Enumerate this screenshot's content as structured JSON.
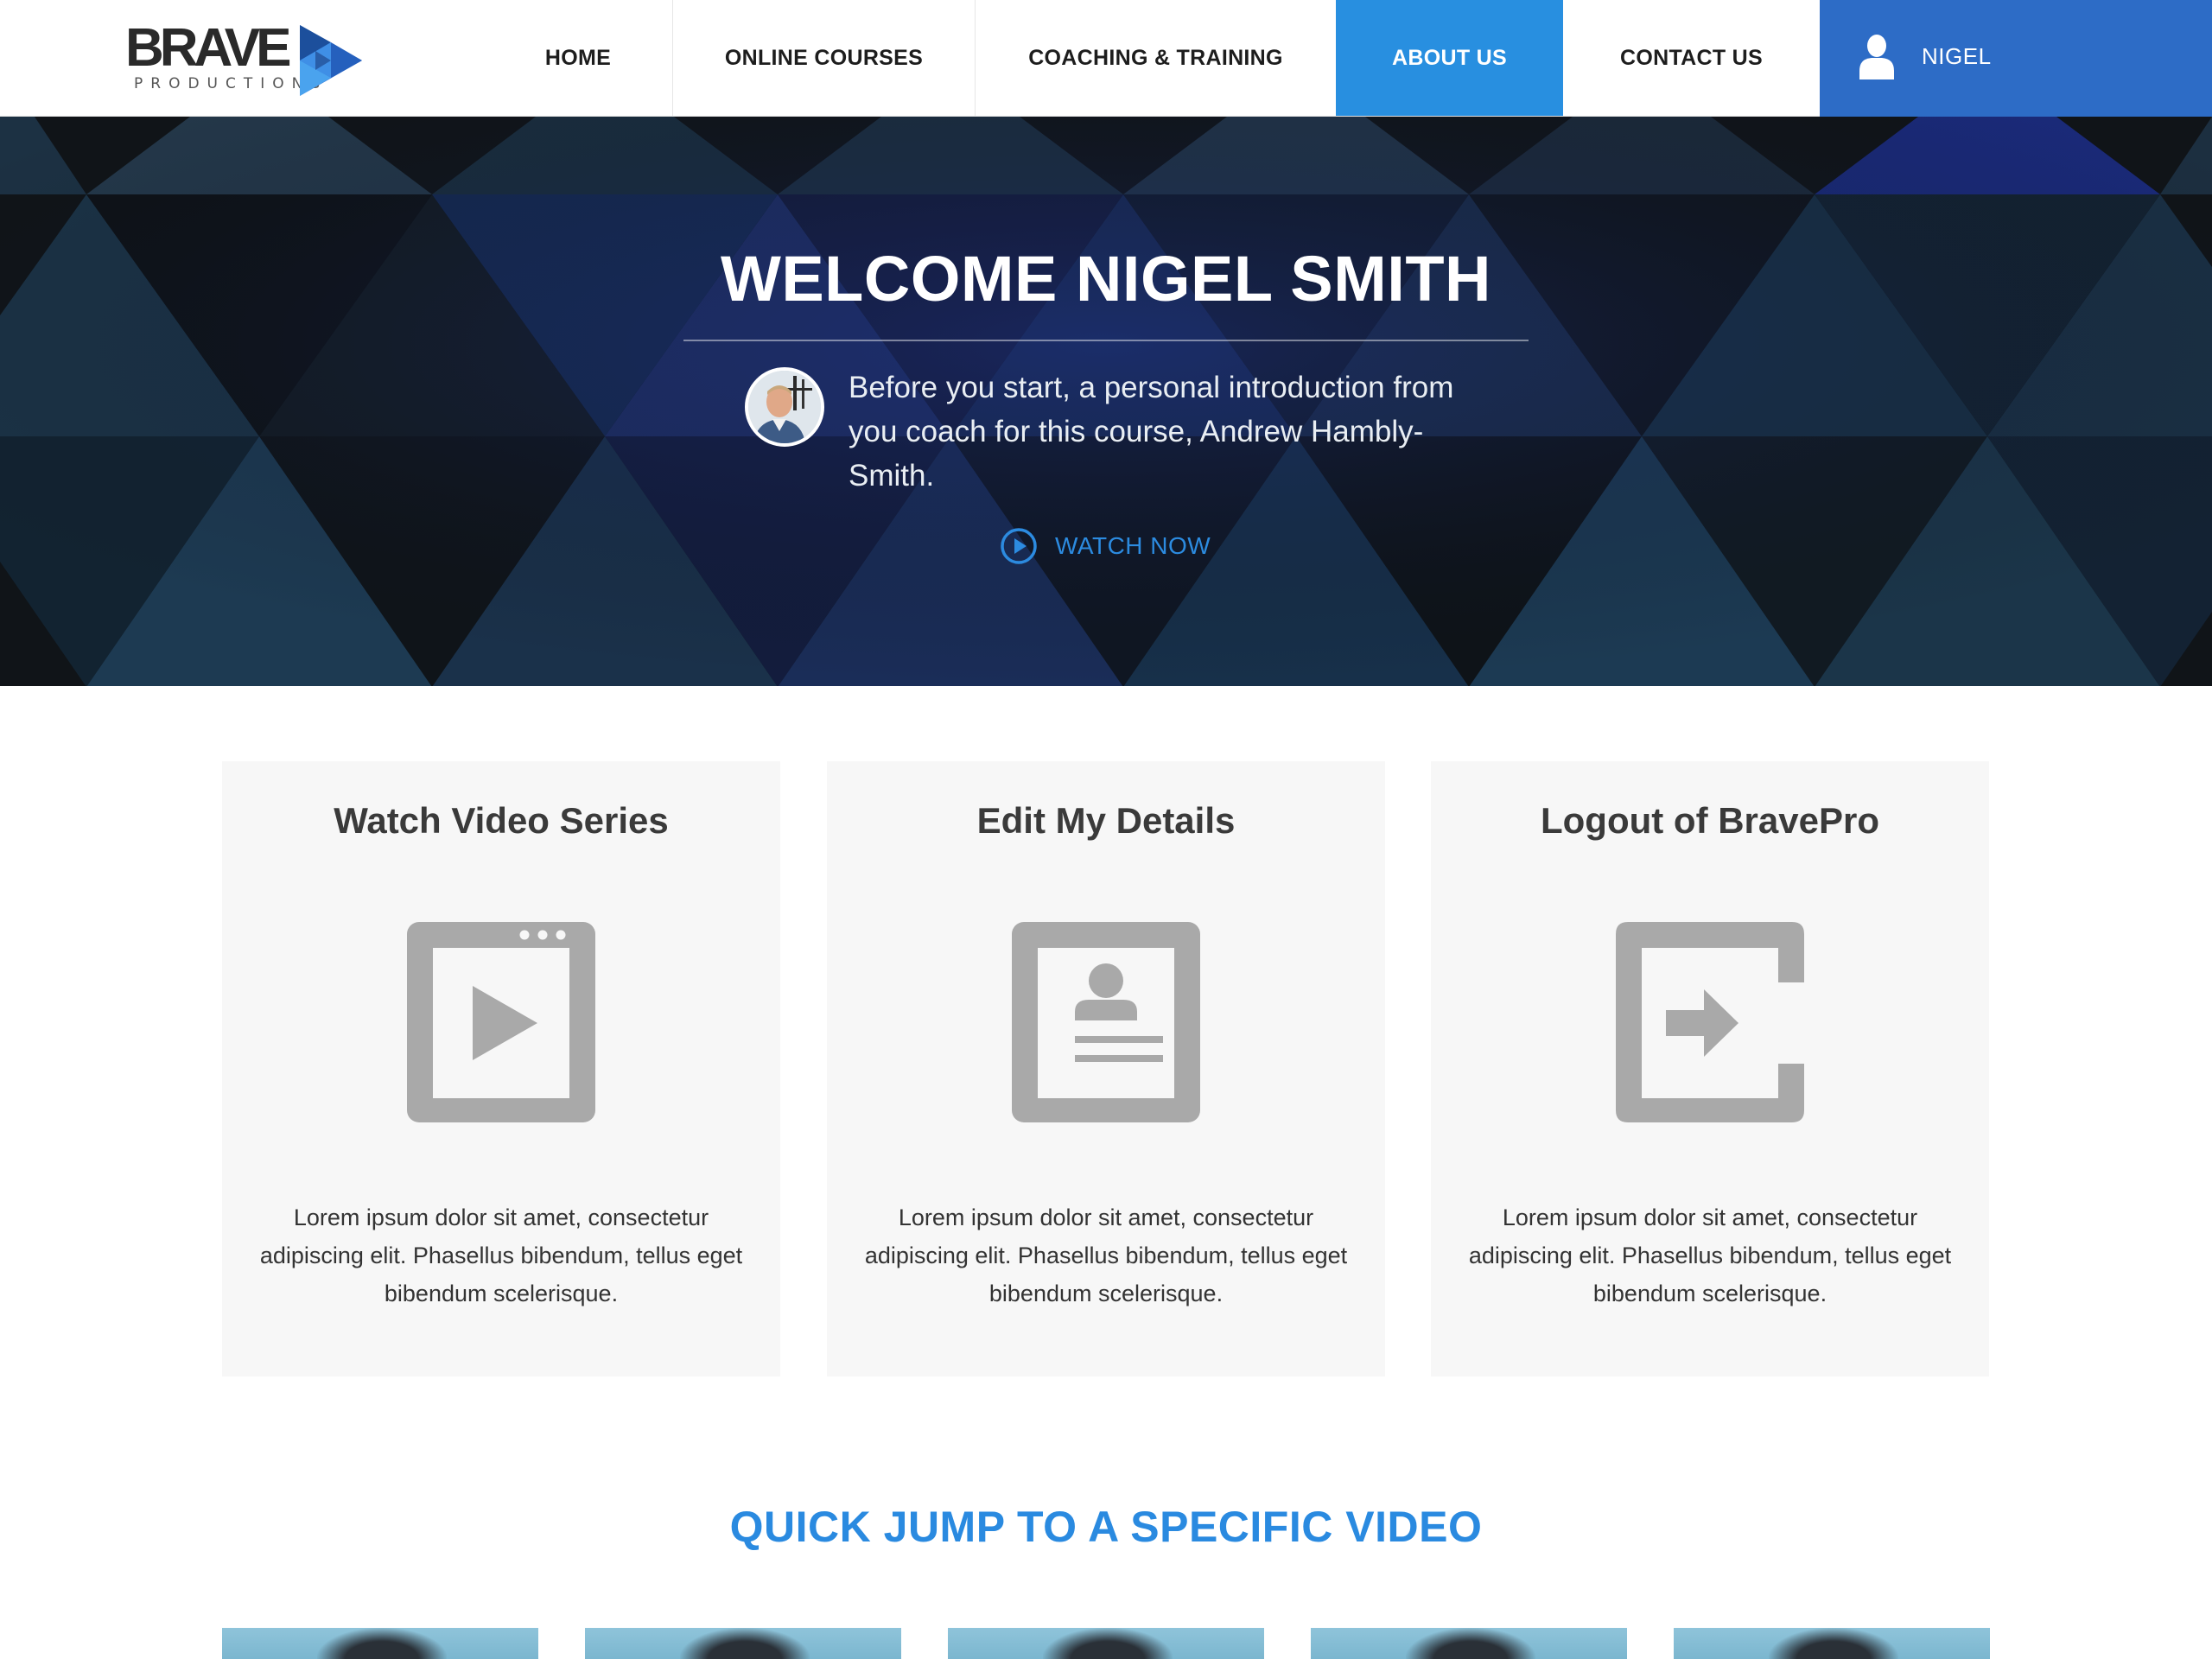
{
  "brand": {
    "name": "BRAVE",
    "tagline": "PRODUCTIONS"
  },
  "nav": {
    "items": [
      {
        "label": "HOME"
      },
      {
        "label": "ONLINE COURSES"
      },
      {
        "label": "COACHING & TRAINING"
      },
      {
        "label": "ABOUT US",
        "active": true
      },
      {
        "label": "CONTACT US"
      }
    ],
    "user_name": "NIGEL",
    "user_icon": "user-icon"
  },
  "hero": {
    "title": "WELCOME NIGEL SMITH",
    "intro": "Before you start, a personal introduction from you coach for this course, Andrew Hambly-Smith.",
    "watch_label": "WATCH NOW",
    "watch_icon": "play-circle-icon"
  },
  "cards": [
    {
      "title": "Watch Video Series",
      "icon": "video-player-icon",
      "description": "Lorem ipsum dolor sit amet, consectetur adipiscing elit. Phasellus bibendum, tellus eget bibendum scelerisque."
    },
    {
      "title": "Edit My Details",
      "icon": "profile-card-icon",
      "description": "Lorem ipsum dolor sit amet, consectetur adipiscing elit. Phasellus bibendum, tellus eget bibendum scelerisque."
    },
    {
      "title": "Logout of BravePro",
      "icon": "logout-icon",
      "description": "Lorem ipsum dolor sit amet, consectetur adipiscing elit. Phasellus bibendum, tellus eget bibendum scelerisque."
    }
  ],
  "quick_jump": {
    "title": "QUICK JUMP TO A SPECIFIC VIDEO"
  },
  "colors": {
    "accent": "#288fe0",
    "user_panel": "#2d6cc6",
    "card_bg": "#f7f7f7",
    "icon_gray": "#a9a9a9",
    "link_blue": "#2c8be0"
  }
}
